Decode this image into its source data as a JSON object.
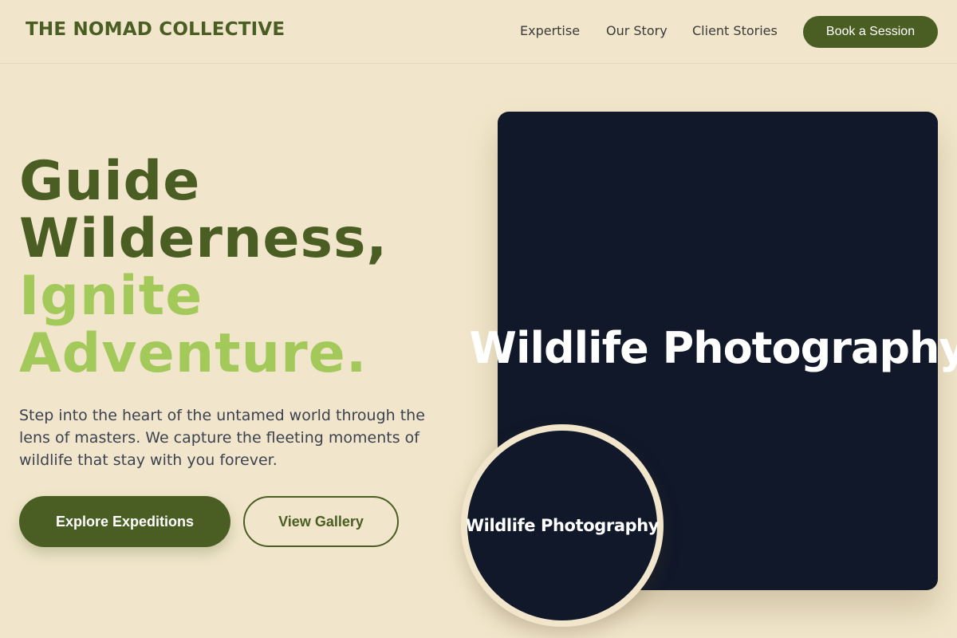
{
  "header": {
    "brand": "THE NOMAD COLLECTIVE",
    "nav": [
      "Expertise",
      "Our Story",
      "Client Stories"
    ],
    "cta": "Book a Session"
  },
  "hero": {
    "title_lines": [
      "Guide",
      "Wilderness,"
    ],
    "accent_lines": [
      "Ignite",
      "Adventure."
    ],
    "description": "Step into the heart of the untamed world through the lens of masters. We capture the fleeting moments of wildlife that stay with you forever.",
    "primary_button": "Explore Expeditions",
    "secondary_button": "View Gallery"
  },
  "media": {
    "main_label": "Wildlife Photography",
    "circle_label": "Wildlife Photography"
  },
  "colors": {
    "background": "#f1e6cb",
    "brand_green": "#4a5e23",
    "accent_green": "#a4c95b",
    "photo_placeholder": "#101829"
  }
}
